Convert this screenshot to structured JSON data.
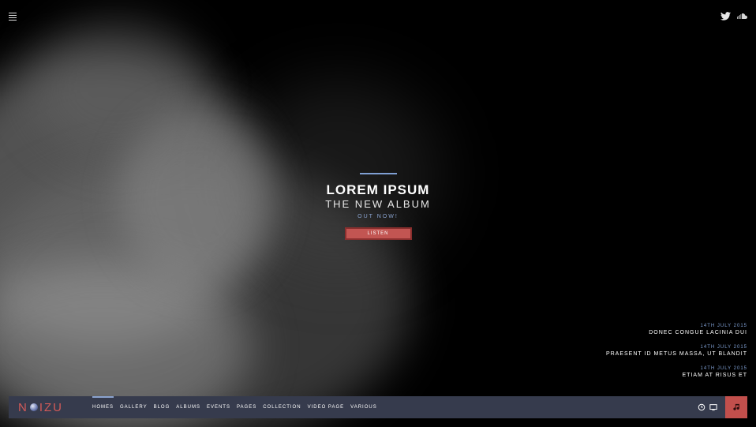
{
  "hero": {
    "title": "LOREM IPSUM",
    "subtitle": "THE NEW ALBUM",
    "tagline": "OUT NOW!",
    "listen_label": "LISTEN"
  },
  "events": [
    {
      "date": "14TH JULY 2015",
      "title": "DONEC CONGUE LACINIA DUI"
    },
    {
      "date": "14TH JULY 2015",
      "title": "PRAESENT ID METUS MASSA, UT BLANDIT"
    },
    {
      "date": "14TH JULY 2015",
      "title": "ETIAM AT RISUS ET"
    }
  ],
  "logo": {
    "left": "N",
    "right": "IZU"
  },
  "nav": {
    "items": [
      "HOMES",
      "GALLERY",
      "BLOG",
      "ALBUMS",
      "EVENTS",
      "PAGES",
      "COLLECTION",
      "VIDEO PAGE",
      "VARIOUS"
    ]
  },
  "icons": {
    "menu": "menu-icon",
    "twitter": "twitter-icon",
    "soundcloud": "soundcloud-icon",
    "clock": "clock-icon",
    "monitor": "monitor-icon",
    "music": "music-note-icon"
  },
  "colors": {
    "accent": "#7f9fd3",
    "brand": "#d25a58",
    "button": "#c25552",
    "navbar": "#363b4d"
  }
}
